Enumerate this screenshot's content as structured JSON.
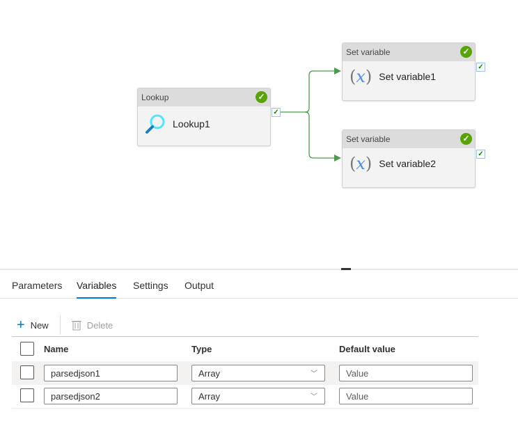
{
  "pipeline": {
    "nodes": [
      {
        "type": "Lookup",
        "name": "Lookup1",
        "status": "succeeded",
        "icon": "magnifier-icon"
      },
      {
        "type": "Set variable",
        "name": "Set variable1",
        "status": "succeeded",
        "icon": "variable-x-icon"
      },
      {
        "type": "Set variable",
        "name": "Set variable2",
        "status": "succeeded",
        "icon": "variable-x-icon"
      }
    ],
    "connector_color": "#4c9a4c"
  },
  "tabs": [
    {
      "label": "Parameters"
    },
    {
      "label": "Variables",
      "active": true
    },
    {
      "label": "Settings"
    },
    {
      "label": "Output"
    }
  ],
  "toolbar": {
    "new_label": "New",
    "delete_label": "Delete"
  },
  "table": {
    "headers": [
      "Name",
      "Type",
      "Default value"
    ],
    "rows": [
      {
        "name": "parsedjson1",
        "type": "Array",
        "default_placeholder": "Value"
      },
      {
        "name": "parsedjson2",
        "type": "Array",
        "default_placeholder": "Value"
      }
    ]
  }
}
